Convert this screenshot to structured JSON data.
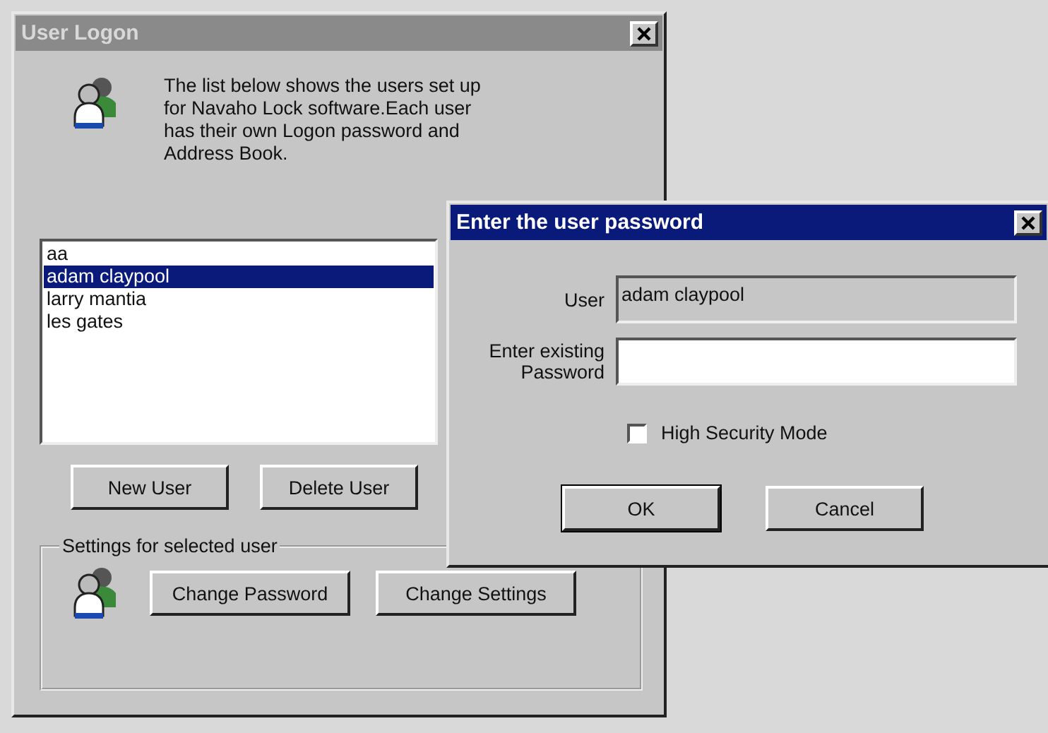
{
  "logon_window": {
    "title": "User Logon",
    "active": false,
    "intro": "The list below shows the users set up for Navaho Lock software.Each user has their own Logon password and Address Book.",
    "users": [
      {
        "name": "aa",
        "selected": false
      },
      {
        "name": "adam claypool",
        "selected": true
      },
      {
        "name": "larry mantia",
        "selected": false
      },
      {
        "name": "les gates",
        "selected": false
      }
    ],
    "buttons": [
      "New User",
      "Delete User"
    ],
    "settings_group": {
      "legend": "Settings for selected user",
      "buttons": [
        "Change Password",
        "Change Settings"
      ]
    }
  },
  "password_dialog": {
    "title": "Enter the user password",
    "active": true,
    "user_label": "User",
    "user_value": "adam claypool",
    "password_label": "Enter existing Password",
    "high_security": {
      "label": "High Security Mode",
      "checked": false
    },
    "buttons": [
      "OK",
      "Cancel"
    ]
  }
}
